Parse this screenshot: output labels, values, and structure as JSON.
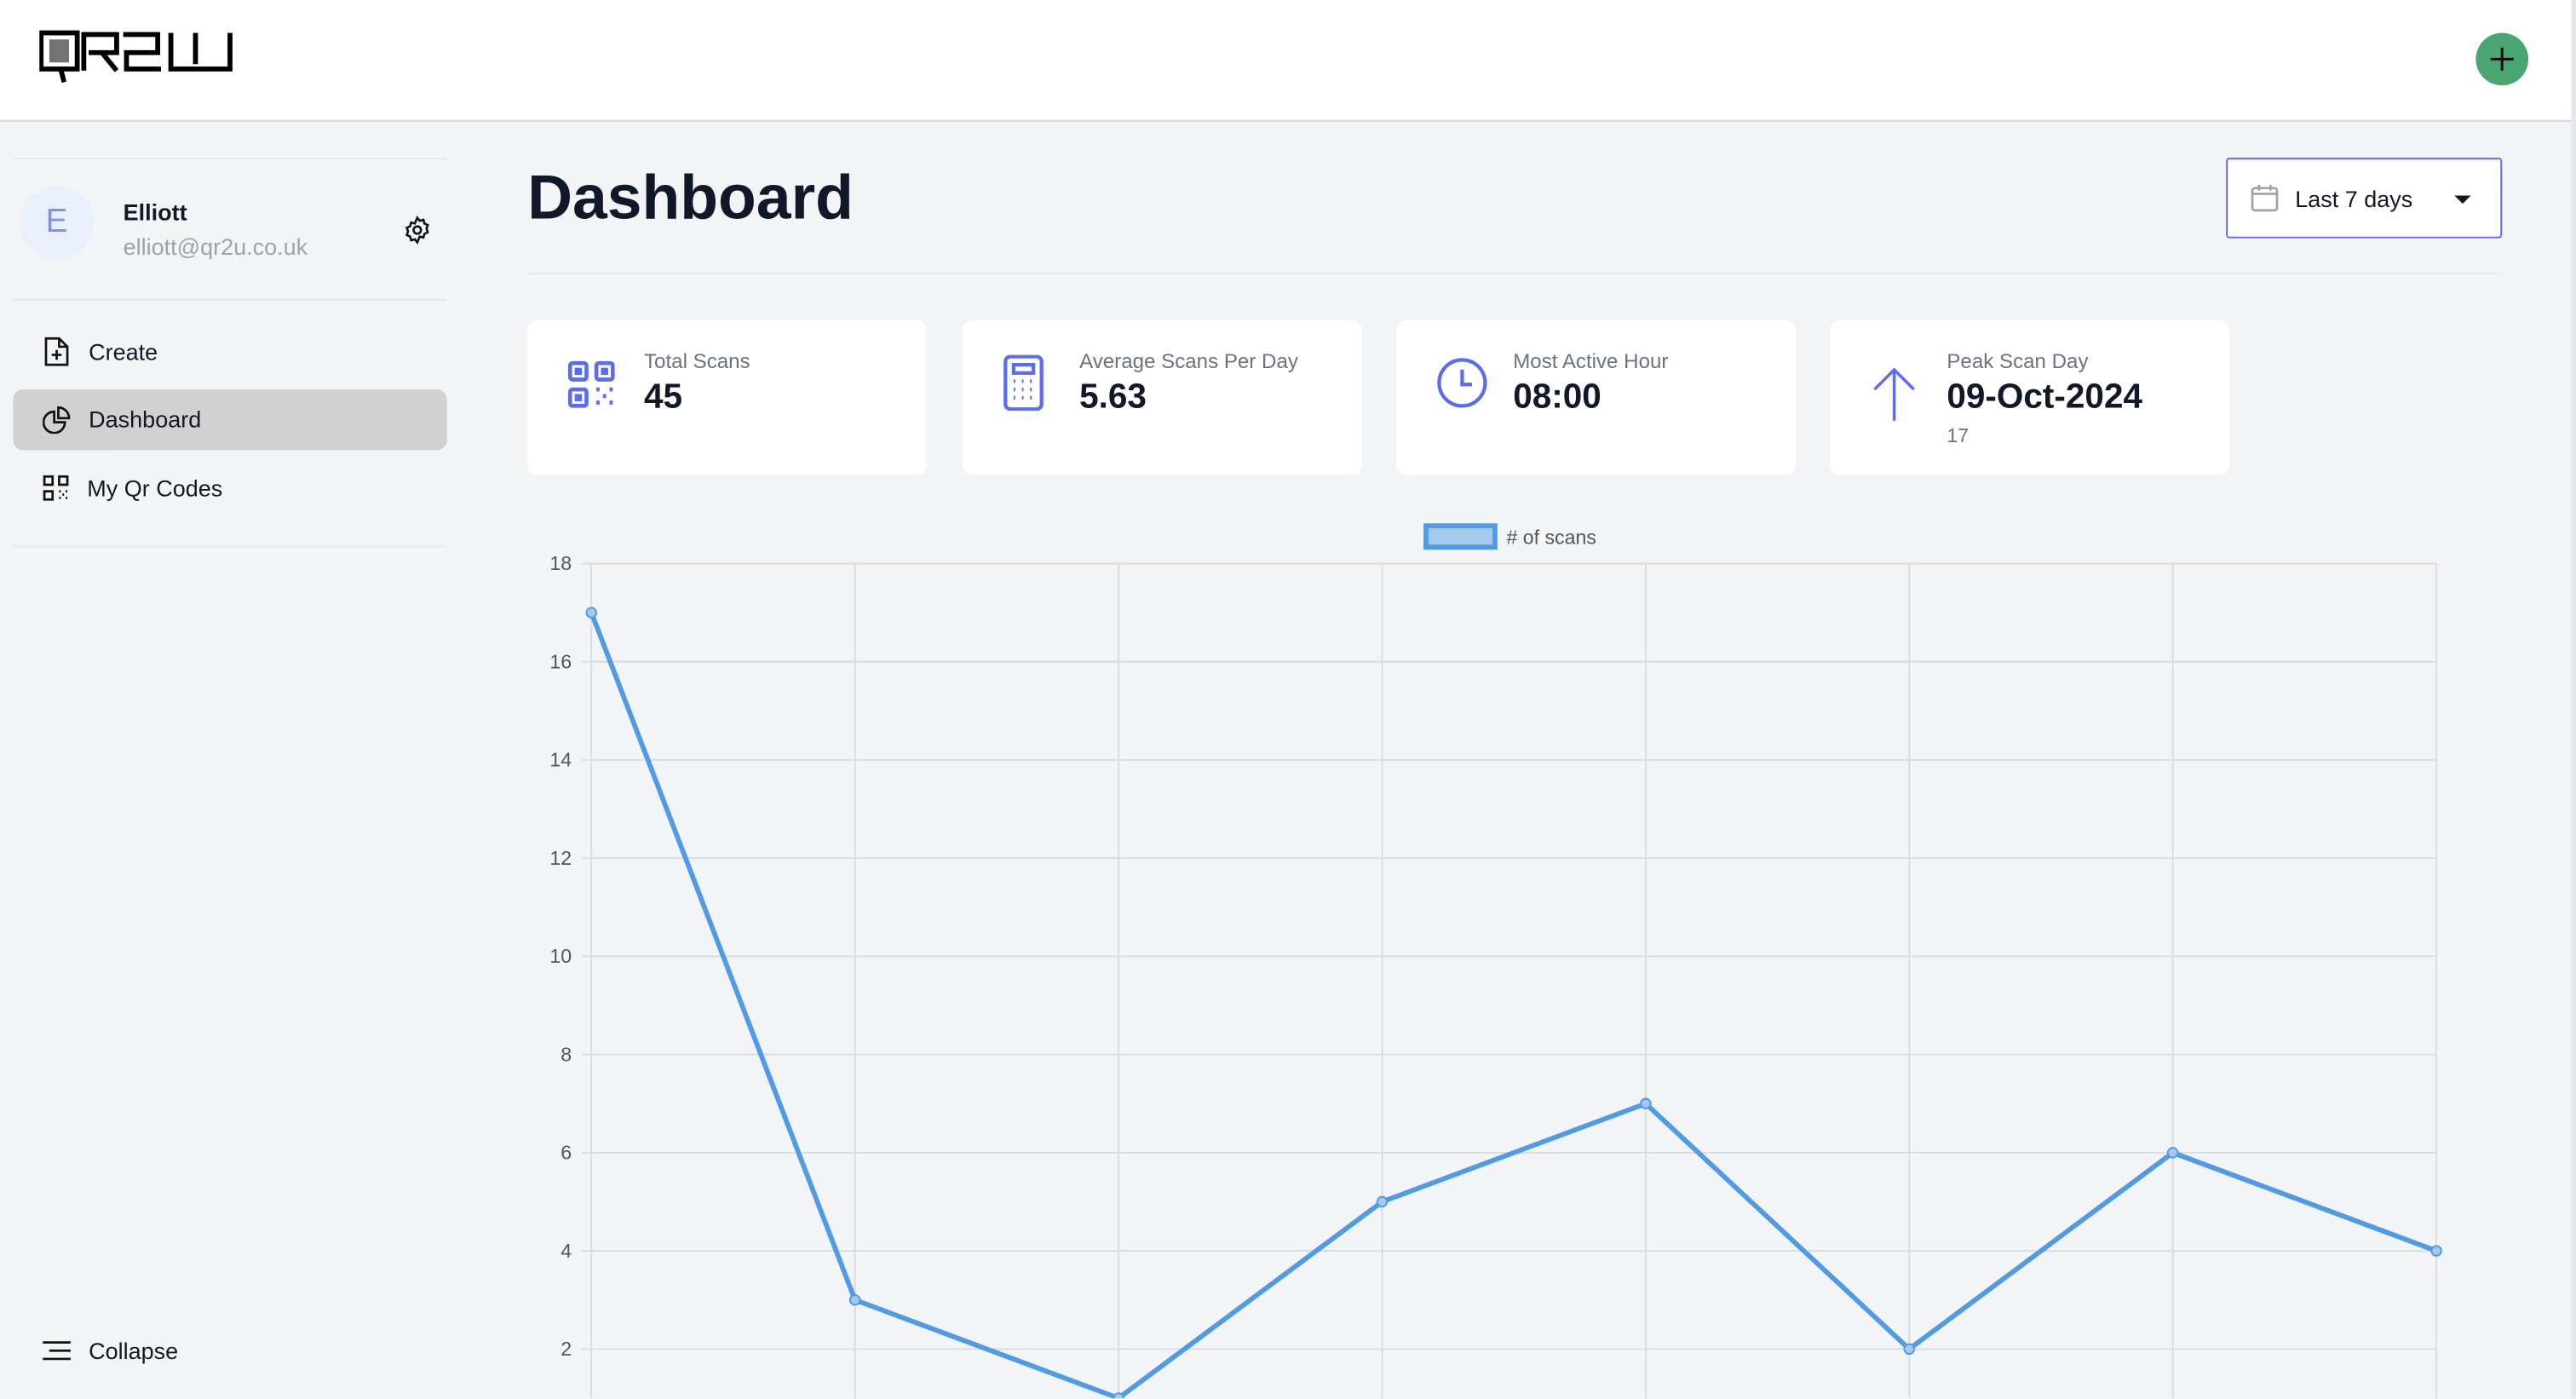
{
  "header": {
    "logo_text": "QR2U",
    "add_button": "+"
  },
  "user": {
    "initial": "E",
    "name": "Elliott",
    "email": "elliott@qr2u.co.uk"
  },
  "sidebar": {
    "items": [
      {
        "label": "Create",
        "icon": "file-plus-icon"
      },
      {
        "label": "Dashboard",
        "icon": "pie-chart-icon",
        "active": true
      },
      {
        "label": "My Qr Codes",
        "icon": "qr-code-icon"
      }
    ],
    "collapse_label": "Collapse"
  },
  "page": {
    "title": "Dashboard"
  },
  "date_range": {
    "selected": "Last 7 days"
  },
  "stats": [
    {
      "label": "Total Scans",
      "value": "45",
      "icon": "qr-code-icon"
    },
    {
      "label": "Average Scans Per Day",
      "value": "5.63",
      "icon": "calculator-icon"
    },
    {
      "label": "Most Active Hour",
      "value": "08:00",
      "icon": "clock-icon"
    },
    {
      "label": "Peak Scan Day",
      "value": "09-Oct-2024",
      "sub": "17",
      "icon": "arrow-up-icon"
    }
  ],
  "colors": {
    "accent": "#5b6cf2",
    "line": "#4f9be6",
    "add_button": "#48a770"
  },
  "chart_data": {
    "type": "line",
    "series": [
      {
        "name": "# of scans",
        "values": [
          17,
          3,
          1,
          5,
          7,
          2,
          6,
          4
        ]
      }
    ],
    "yticks": [
      2,
      4,
      6,
      8,
      10,
      12,
      14,
      16,
      18
    ],
    "ylim": [
      0,
      18
    ],
    "grid": true,
    "legend": "top"
  }
}
